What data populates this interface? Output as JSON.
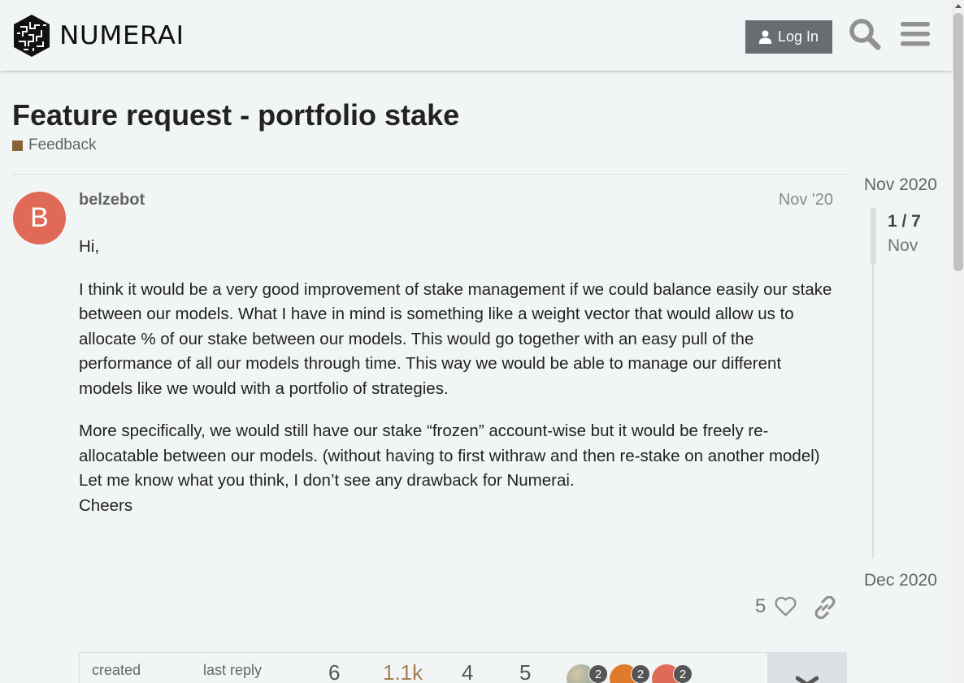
{
  "header": {
    "brand": "NUMERAI",
    "login_label": "Log In",
    "icons": [
      "numerai-logo-icon",
      "user-icon",
      "search-icon",
      "hamburger-menu-icon"
    ]
  },
  "topic": {
    "title": "Feature request - portfolio stake",
    "category": "Feedback",
    "category_color": "#8c6238"
  },
  "post": {
    "avatar_letter": "B",
    "avatar_color": "#e06a57",
    "username": "belzebot",
    "date": "Nov '20",
    "paragraphs": [
      "Hi,",
      "I think it would be a very good improvement of stake management if we could balance easily our stake between our models. What I have in mind is something like a weight vector that would allow us to allocate % of our stake between our models. This would go together with an easy pull of the performance of all our models through time. This way we would be able to manage our different models like we would with a portfolio of strategies.",
      "More specifically, we would still have our stake “frozen” account-wise but it would be freely re-allocatable between our models. (without having to first withraw and then re-stake on another model)",
      "Let me know what you think, I don’t see any drawback for Numerai.",
      "Cheers"
    ],
    "likes": "5"
  },
  "topic_map": {
    "created_label": "created",
    "last_reply_label": "last reply",
    "replies": "6",
    "views": "1.1k",
    "users": "4",
    "likes": "5",
    "participants": [
      {
        "count": "2",
        "color": "#c9a77c"
      },
      {
        "count": "2",
        "color": "#e07b2c"
      },
      {
        "count": "2",
        "color": "#e06a57"
      }
    ]
  },
  "timeline": {
    "start": "Nov 2020",
    "position": "1 / 7",
    "current_date": "Nov",
    "end": "Dec 2020"
  }
}
